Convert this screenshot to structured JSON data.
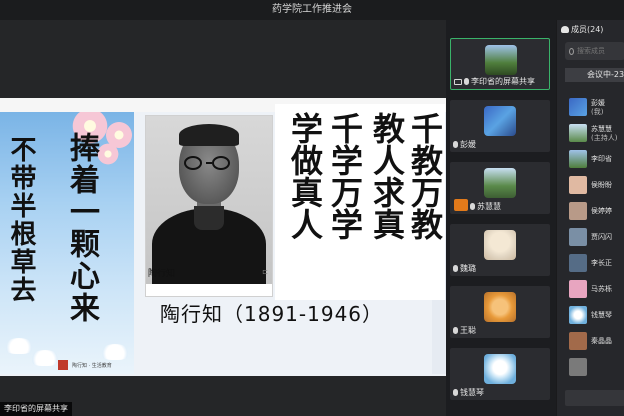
{
  "window": {
    "title": "药学院工作推进会"
  },
  "slide": {
    "left_callig": {
      "col1": "不带半根草去",
      "col2": "捧着一颗心来",
      "small": "陶行知 · 生活教育"
    },
    "portrait_name": "陶行知",
    "right_callig": [
      "千教万教",
      "教人求真",
      "千学万学",
      "学做真人"
    ],
    "caption": "陶行知（1891-1946）"
  },
  "share_tag": "李印省的屏幕共享",
  "gallery": [
    {
      "label": "李印省的屏幕共享",
      "color": "#4f7e3c",
      "active": true,
      "mode": "share"
    },
    {
      "label": "彭媛",
      "color": "#3a68c4"
    },
    {
      "label": "苏慧慧",
      "color": "#5a8a4a",
      "badge": true
    },
    {
      "label": "魏璐",
      "color": "#e3d7c4"
    },
    {
      "label": "王聪",
      "color": "#e89a3a"
    },
    {
      "label": "钱慧琴",
      "color": "#6fb0dd"
    }
  ],
  "members": {
    "header": "成员(24)",
    "search_placeholder": "搜索成员",
    "tab": "会议中-23",
    "items": [
      {
        "name": "彭媛",
        "sub": "(我)",
        "color": "#3a68c4"
      },
      {
        "name": "苏慧慧",
        "sub": "(主持人)",
        "color": "#5a8a4a"
      },
      {
        "name": "李印省",
        "color": "#4f7e3c"
      },
      {
        "name": "侯盼盼",
        "color": "#e0b9a2"
      },
      {
        "name": "侯婷婷",
        "color": "#b89a88"
      },
      {
        "name": "贾闪闪",
        "color": "#7a8fa5"
      },
      {
        "name": "李长正",
        "color": "#556c86"
      },
      {
        "name": "马苏栎",
        "color": "#e8a5c0"
      },
      {
        "name": "钱慧琴",
        "color": "#6fb0dd"
      },
      {
        "name": "秦晶晶",
        "color": "#a26a4a"
      },
      {
        "name": "",
        "color": "#7a7a7a"
      }
    ]
  }
}
